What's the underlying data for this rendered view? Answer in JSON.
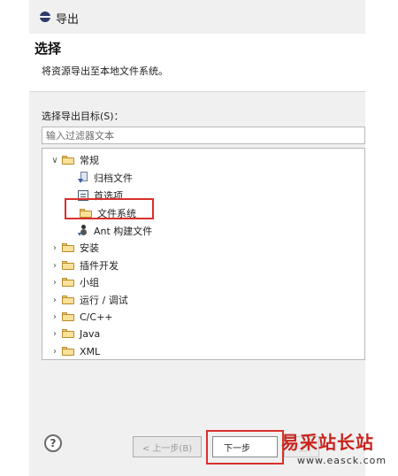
{
  "window": {
    "title": "导出"
  },
  "header": {
    "title": "选择",
    "description": "将资源导出至本地文件系统。"
  },
  "content": {
    "target_label": "选择导出目标(S)：",
    "filter_placeholder": "输入过滤器文本"
  },
  "tree": {
    "items": [
      {
        "label": "常规",
        "expanded": true,
        "icon": "folder-icon",
        "level": 0
      },
      {
        "label": "归档文件",
        "icon": "archive-file-icon",
        "level": 1
      },
      {
        "label": "首选项",
        "icon": "preferences-icon",
        "level": 1
      },
      {
        "label": "文件系统",
        "icon": "folder-icon",
        "level": 1,
        "selected": true
      },
      {
        "label": "Ant 构建文件",
        "icon": "ant-icon",
        "level": 1
      },
      {
        "label": "安装",
        "expanded": false,
        "icon": "folder-icon",
        "level": 0
      },
      {
        "label": "插件开发",
        "expanded": false,
        "icon": "folder-icon",
        "level": 0
      },
      {
        "label": "小组",
        "expanded": false,
        "icon": "folder-icon",
        "level": 0
      },
      {
        "label": "运行 / 调试",
        "expanded": false,
        "icon": "folder-icon",
        "level": 0
      },
      {
        "label": "C/C++",
        "expanded": false,
        "icon": "folder-icon",
        "level": 0
      },
      {
        "label": "Java",
        "expanded": false,
        "icon": "folder-icon",
        "level": 0
      },
      {
        "label": "XML",
        "expanded": false,
        "icon": "folder-icon",
        "level": 0
      }
    ]
  },
  "footer": {
    "help_label": "?",
    "back_label": "< 上一步(B)",
    "next_label": "下一步",
    "next_shadow_label": "< 上"
  },
  "watermark": {
    "text": "易采站长站",
    "url": "www.easck.com"
  },
  "colors": {
    "highlight_red": "#d9302c",
    "window_bg": "#f0f0f0",
    "folder_yellow": "#f9e19a"
  }
}
